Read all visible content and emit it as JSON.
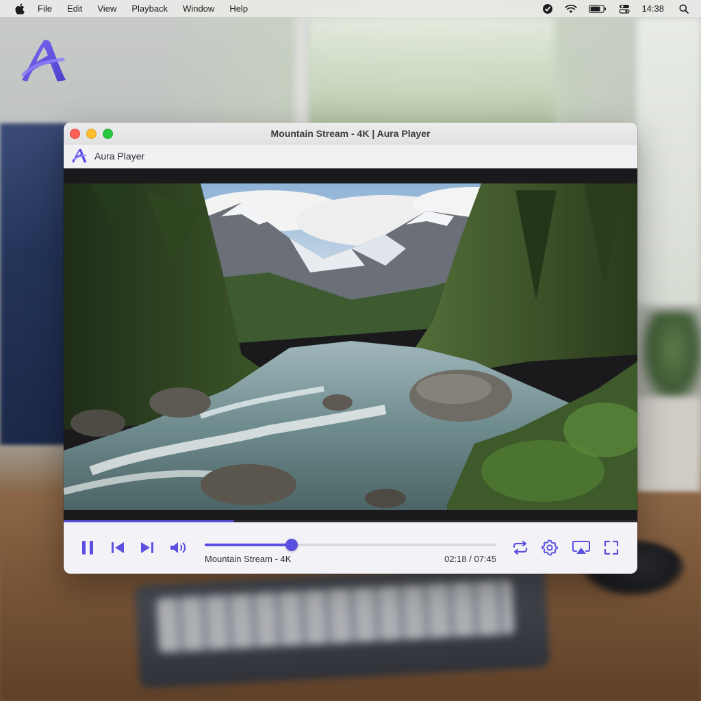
{
  "menubar": {
    "items": [
      "File",
      "Edit",
      "View",
      "Playback",
      "Window",
      "Help"
    ],
    "clock": "14:38",
    "status_icons": [
      "focus-icon",
      "wifi-icon",
      "battery-icon",
      "control-center-icon",
      "search-icon"
    ]
  },
  "window": {
    "title": "Mountain Stream - 4K | Aura Player"
  },
  "app": {
    "name": "Aura Player"
  },
  "player": {
    "track_title": "Mountain Stream - 4K",
    "elapsed": "02:18",
    "duration": "07:45",
    "time_display": "02:18 / 07:45",
    "progress_fraction": 0.297,
    "state": "playing"
  },
  "theme": {
    "accent": "#5b4fe0",
    "window_bg": "#f3f3f6"
  },
  "controls": {
    "left": [
      "pause-icon",
      "previous-icon",
      "next-icon",
      "volume-icon"
    ],
    "right": [
      "repeat-icon",
      "settings-icon",
      "airplay-icon",
      "fullscreen-icon"
    ]
  }
}
